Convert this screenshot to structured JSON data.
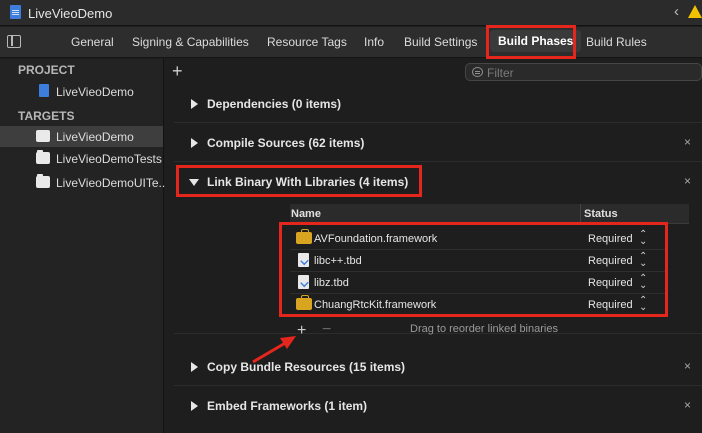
{
  "window": {
    "title": "LiveVieoDemo"
  },
  "tabs": [
    {
      "label": "General"
    },
    {
      "label": "Signing & Capabilities"
    },
    {
      "label": "Resource Tags"
    },
    {
      "label": "Info"
    },
    {
      "label": "Build Settings"
    },
    {
      "label": "Build Phases",
      "active": true
    },
    {
      "label": "Build Rules"
    }
  ],
  "sidebar": {
    "project_header": "PROJECT",
    "project": "LiveVieoDemo",
    "targets_header": "TARGETS",
    "targets": [
      {
        "label": "LiveVieoDemo",
        "selected": true
      },
      {
        "label": "LiveVieoDemoTests"
      },
      {
        "label": "LiveVieoDemoUITe..."
      }
    ]
  },
  "main": {
    "add_label": "+",
    "filter_placeholder": "Filter",
    "phases": [
      {
        "title": "Dependencies (0 items)",
        "closable": false
      },
      {
        "title": "Compile Sources (62 items)",
        "closable": true
      },
      {
        "title": "Link Binary With Libraries (4 items)",
        "closable": true,
        "expanded": true
      },
      {
        "title": "Copy Bundle Resources (15 items)",
        "closable": true
      },
      {
        "title": "Embed Frameworks (1 item)",
        "closable": true
      }
    ],
    "close_glyph": "×",
    "libraries": {
      "col_name": "Name",
      "col_status": "Status",
      "rows": [
        {
          "name": "AVFoundation.framework",
          "status": "Required",
          "icon": "framework-icon"
        },
        {
          "name": "libc++.tbd",
          "status": "Required",
          "icon": "tbd-file-icon"
        },
        {
          "name": "libz.tbd",
          "status": "Required",
          "icon": "tbd-file-icon"
        },
        {
          "name": "ChuangRtcKit.framework",
          "status": "Required",
          "icon": "framework-icon"
        }
      ],
      "add_label": "+",
      "remove_label": "−",
      "drag_hint": "Drag to reorder linked binaries"
    }
  },
  "colors": {
    "highlight": "#e5261c",
    "framework": "#d9a520",
    "file": "#3d7ddb"
  }
}
